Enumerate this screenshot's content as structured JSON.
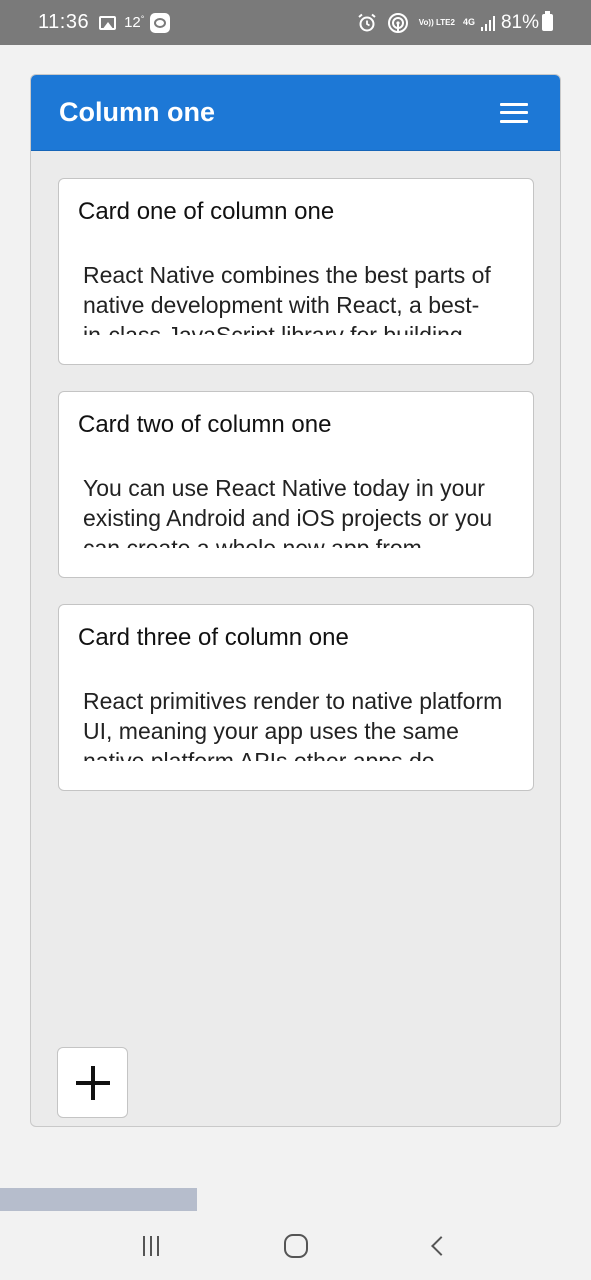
{
  "status_bar": {
    "time": "11:36",
    "temperature": "12",
    "degree": "°",
    "volte": "Vo)) LTE2",
    "network": "4G",
    "battery": "81%"
  },
  "column": {
    "title": "Column one",
    "cards": [
      {
        "title": "Card one of column one",
        "body": "React Native combines the best parts of native development with React, a best-in-class JavaScript library for building user interfaces."
      },
      {
        "title": "Card two of column one",
        "body": "You can use React Native today in your existing Android and iOS projects or you can create a whole new app from scratch."
      },
      {
        "title": "Card three of column one",
        "body": "React primitives render to native platform UI, meaning your app uses the same native platform APIs other apps do."
      }
    ],
    "add_label": ""
  },
  "icons": {
    "menu": "hamburger-menu-icon",
    "add": "plus-icon"
  }
}
